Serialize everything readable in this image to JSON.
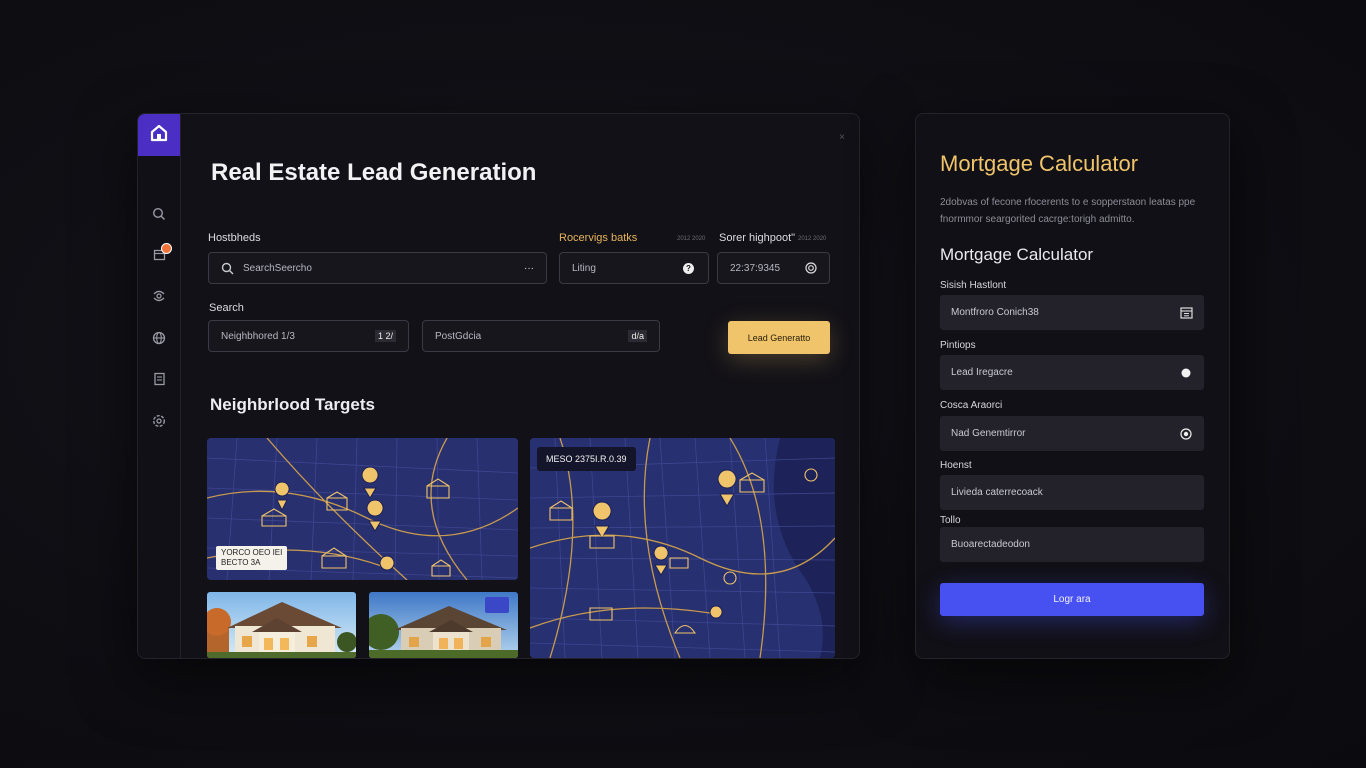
{
  "app": {
    "title": "Real Estate Lead Generation",
    "close_glyph": "×"
  },
  "sidebar": {
    "logo_icon": "house-icon",
    "items": [
      {
        "icon": "search-icon"
      },
      {
        "icon": "calendar-icon",
        "badge": true
      },
      {
        "icon": "filter-icon"
      },
      {
        "icon": "globe-icon"
      },
      {
        "icon": "document-icon"
      },
      {
        "icon": "settings-icon"
      }
    ]
  },
  "filters": {
    "row1_label_a": "Hostbheds",
    "row1_label_b": "Rocervigs batks",
    "row1_label_b_meta": "2012 2020",
    "row1_label_c": "Sorer highpoot\"",
    "row1_label_c_meta": "2012 2020",
    "search_value": "SearchSeercho",
    "search_more": "···",
    "listing_value": "Liting",
    "listing_help": "?",
    "time_value": "22:37:9345",
    "row2_label": "Search",
    "neighborhood_value": "Neighbhored 1/3",
    "neighborhood_badge": "1 2/",
    "postal_value": "PostGdcia",
    "postal_badge": "d/a",
    "lead_button": "Lead Generatto"
  },
  "targets": {
    "heading": "Neighbrlood Targets",
    "map1_tag_line1": "YORCO OEO IEI",
    "map1_tag_line2": "BECTO 3A",
    "map2_tag": "MESO 2375I.R.0.39"
  },
  "mortgage": {
    "title": "Mortgage Calculator",
    "description": "2dobvas of fecone rfocerents to e sopperstaon leatas ppe fnormmor seargorited cacrge:torigh admitto.",
    "subtitle": "Mortgage Calculator",
    "fields": [
      {
        "label": "Sisish Hastlont",
        "value": "Montfroro Conich38",
        "icon": "calendar-icon"
      },
      {
        "label": "Pintiops",
        "value": "Lead Iregacre",
        "icon": "dot-icon"
      },
      {
        "label": "Cosca Araorci",
        "value": "Nad Genemtirror",
        "icon": "target-icon"
      },
      {
        "label": "Hoenst",
        "value": "Livieda caterrecoack",
        "icon": ""
      },
      {
        "label": "Tollo",
        "value": "Buoarectadeodon",
        "icon": ""
      }
    ],
    "submit": "Logr ara"
  },
  "colors": {
    "accent_purple": "#4b2fc4",
    "accent_gold": "#f0c46a",
    "accent_blue": "#4750f0",
    "map_navy": "#2a2f70"
  }
}
